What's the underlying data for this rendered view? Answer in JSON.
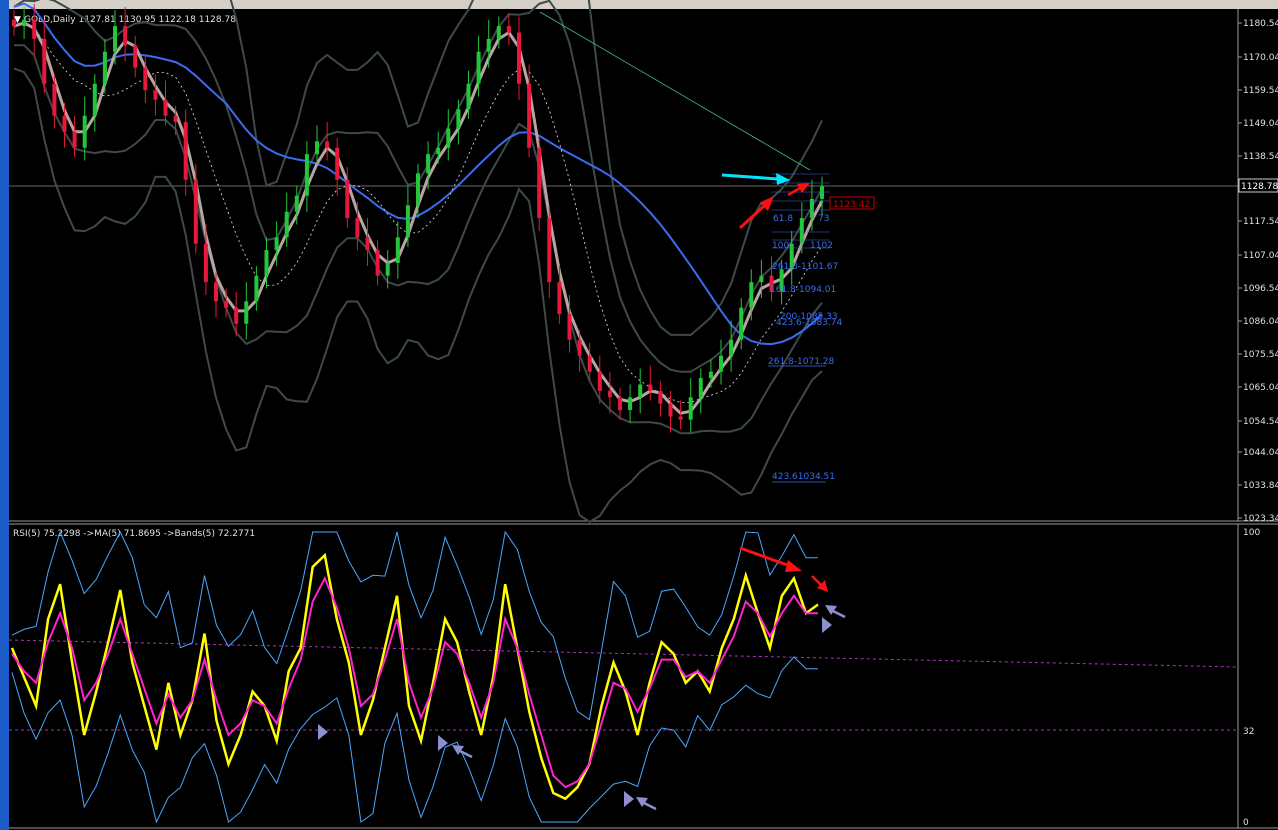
{
  "window": {
    "symbol_header": "GOLD,Daily  1127.81 1130.95 1122.18 1128.78",
    "menu_glyph": "▼"
  },
  "price_axis": {
    "ticks": [
      "1180.54",
      "1170.04",
      "1159.54",
      "1149.04",
      "1138.54",
      "1117.54",
      "1107.04",
      "1096.54",
      "1086.04",
      "1075.54",
      "1065.04",
      "1054.54",
      "1044.04",
      "1033.84",
      "1023.34"
    ],
    "current_price": "1128.78",
    "current_price_color": "#ffffff",
    "crosshair_price_box": "1123.42",
    "crosshair_price_color": "#cc0000"
  },
  "rsi_panel": {
    "header": "RSI(5) 75.2298  ->MA(5) 71.8695  ->Bands(5) 72.2771",
    "axis_ticks": [
      "100",
      "32",
      "0"
    ]
  },
  "fib_labels": [
    "261.8-1101.67",
    "161.8-1094.01",
    "200-1085.33",
    "423.6-1083.74",
    "261.8-1071.28",
    "423.61034.51",
    "61.8",
    "73",
    "100",
    "1102"
  ],
  "colors": {
    "background": "#000000",
    "bull_candle": "#22c73a",
    "bear_candle": "#e8173c",
    "ma_blue": "#3b6cf0",
    "bands_gray": "#3d4a49",
    "ma_fast": "#b8a5a1",
    "rsi_yellow": "#ffff00",
    "rsi_ma_magenta": "#ff22cc",
    "rsi_bands_cyan": "#4aa8ff",
    "level_dashed": "#b030c0",
    "arrow_red": "#ff1010",
    "arrow_cyan": "#00e5ff",
    "arrow_gray": "#8f8fd0",
    "fib_blue": "#3b6cf0"
  },
  "chart_data": [
    {
      "type": "line",
      "title": "GOLD,Daily",
      "x": "bar index (daily)",
      "ylim": [
        1023.34,
        1180.54
      ],
      "series": [
        {
          "name": "price",
          "values": [
            1178,
            1180,
            1174,
            1160,
            1150,
            1145,
            1140,
            1150,
            1160,
            1170,
            1178,
            1172,
            1165,
            1158,
            1155,
            1150,
            1148,
            1130,
            1110,
            1098,
            1092,
            1090,
            1085,
            1092,
            1100,
            1108,
            1112,
            1120,
            1125,
            1138,
            1142,
            1140,
            1130,
            1118,
            1112,
            1108,
            1100,
            1104,
            1112,
            1122,
            1132,
            1138,
            1140,
            1146,
            1152,
            1160,
            1170,
            1174,
            1178,
            1176,
            1160,
            1140,
            1118,
            1098,
            1088,
            1080,
            1075,
            1070,
            1064,
            1062,
            1058,
            1062,
            1066,
            1064,
            1060,
            1056,
            1055,
            1062,
            1068,
            1070,
            1075,
            1080,
            1090,
            1098,
            1100,
            1095,
            1102,
            1110,
            1118,
            1124,
            1128
          ]
        }
      ]
    },
    {
      "type": "line",
      "title": "RSI(5)",
      "ylim": [
        0,
        100
      ],
      "series": [
        {
          "name": "RSI(5)",
          "values": [
            60,
            50,
            40,
            70,
            82,
            55,
            30,
            45,
            62,
            80,
            55,
            40,
            25,
            48,
            30,
            42,
            65,
            35,
            20,
            30,
            45,
            40,
            28,
            52,
            60,
            88,
            92,
            70,
            55,
            30,
            42,
            60,
            78,
            40,
            28,
            48,
            70,
            62,
            45,
            30,
            50,
            82,
            60,
            38,
            22,
            10,
            8,
            12,
            20,
            40,
            55,
            45,
            30,
            48,
            62,
            58,
            48,
            52,
            45,
            60,
            70,
            85,
            72,
            60,
            78,
            84,
            72,
            75
          ]
        },
        {
          "name": "MA(5)",
          "values": [
            58,
            52,
            48,
            62,
            72,
            60,
            42,
            48,
            58,
            70,
            58,
            46,
            34,
            44,
            36,
            42,
            56,
            42,
            30,
            34,
            42,
            40,
            34,
            46,
            56,
            76,
            84,
            74,
            60,
            40,
            44,
            56,
            70,
            48,
            36,
            46,
            62,
            58,
            48,
            36,
            48,
            70,
            60,
            44,
            30,
            16,
            12,
            14,
            20,
            34,
            48,
            46,
            38,
            46,
            56,
            56,
            50,
            52,
            48,
            56,
            64,
            76,
            72,
            64,
            72,
            78,
            72,
            72
          ]
        }
      ]
    }
  ]
}
